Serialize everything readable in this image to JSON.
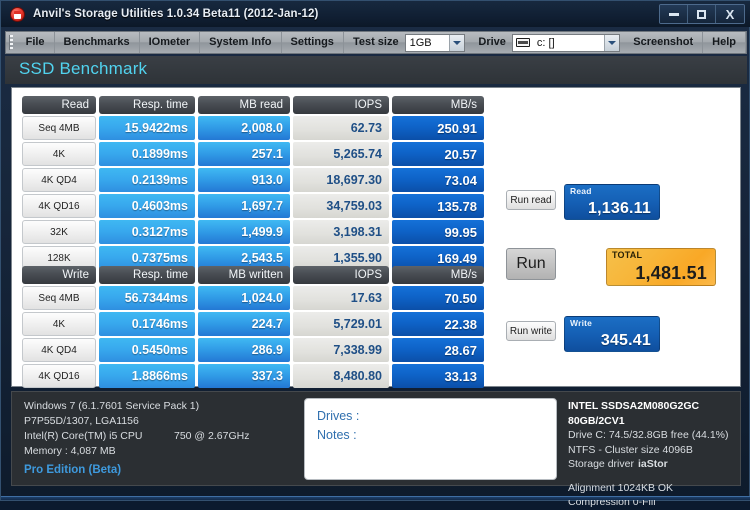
{
  "window": {
    "title": "Anvil's Storage Utilities 1.0.34 Beta11 (2012-Jan-12)",
    "app_icon": "anvil-icon",
    "minimize_label": "",
    "maximize_label": "",
    "close_label": "X"
  },
  "menu": {
    "items": [
      "File",
      "Benchmarks",
      "IOmeter",
      "System Info",
      "Settings"
    ],
    "test_size_label": "Test size",
    "test_size_value": "1GB",
    "drive_label": "Drive",
    "drive_value": "c: []",
    "screenshot_label": "Screenshot",
    "help_label": "Help"
  },
  "header": {
    "title": "SSD Benchmark",
    "accent_color": "#51d3ef"
  },
  "chart_data": {
    "type": "table",
    "title": "SSD Benchmark",
    "tables": [
      {
        "name": "Read",
        "columns": [
          "Read",
          "Resp. time",
          "MB read",
          "IOPS",
          "MB/s"
        ],
        "rows": [
          [
            "Seq 4MB",
            "15.9422ms",
            "2,008.0",
            "62.73",
            "250.91"
          ],
          [
            "4K",
            "0.1899ms",
            "257.1",
            "5,265.74",
            "20.57"
          ],
          [
            "4K QD4",
            "0.2139ms",
            "913.0",
            "18,697.30",
            "73.04"
          ],
          [
            "4K QD16",
            "0.4603ms",
            "1,697.7",
            "34,759.03",
            "135.78"
          ],
          [
            "32K",
            "0.3127ms",
            "1,499.9",
            "3,198.31",
            "99.95"
          ],
          [
            "128K",
            "0.7375ms",
            "2,543.5",
            "1,355.90",
            "169.49"
          ]
        ]
      },
      {
        "name": "Write",
        "columns": [
          "Write",
          "Resp. time",
          "MB written",
          "IOPS",
          "MB/s"
        ],
        "rows": [
          [
            "Seq 4MB",
            "56.7344ms",
            "1,024.0",
            "17.63",
            "70.50"
          ],
          [
            "4K",
            "0.1746ms",
            "224.7",
            "5,729.01",
            "22.38"
          ],
          [
            "4K QD4",
            "0.5450ms",
            "286.9",
            "7,338.99",
            "28.67"
          ],
          [
            "4K QD16",
            "1.8866ms",
            "337.3",
            "8,480.80",
            "33.13"
          ]
        ]
      }
    ],
    "scores": {
      "read": 1136.11,
      "write": 345.41,
      "total": 1481.51
    }
  },
  "read_table": {
    "headers": {
      "label": "Read",
      "resp": "Resp. time",
      "mb": "MB read",
      "iops": "IOPS",
      "mbs": "MB/s"
    },
    "rows": [
      {
        "label": "Seq 4MB",
        "resp": "15.9422ms",
        "mb": "2,008.0",
        "iops": "62.73",
        "mbs": "250.91"
      },
      {
        "label": "4K",
        "resp": "0.1899ms",
        "mb": "257.1",
        "iops": "5,265.74",
        "mbs": "20.57"
      },
      {
        "label": "4K QD4",
        "resp": "0.2139ms",
        "mb": "913.0",
        "iops": "18,697.30",
        "mbs": "73.04"
      },
      {
        "label": "4K QD16",
        "resp": "0.4603ms",
        "mb": "1,697.7",
        "iops": "34,759.03",
        "mbs": "135.78"
      },
      {
        "label": "32K",
        "resp": "0.3127ms",
        "mb": "1,499.9",
        "iops": "3,198.31",
        "mbs": "99.95"
      },
      {
        "label": "128K",
        "resp": "0.7375ms",
        "mb": "2,543.5",
        "iops": "1,355.90",
        "mbs": "169.49"
      }
    ]
  },
  "write_table": {
    "headers": {
      "label": "Write",
      "resp": "Resp. time",
      "mb": "MB written",
      "iops": "IOPS",
      "mbs": "MB/s"
    },
    "rows": [
      {
        "label": "Seq 4MB",
        "resp": "56.7344ms",
        "mb": "1,024.0",
        "iops": "17.63",
        "mbs": "70.50"
      },
      {
        "label": "4K",
        "resp": "0.1746ms",
        "mb": "224.7",
        "iops": "5,729.01",
        "mbs": "22.38"
      },
      {
        "label": "4K QD4",
        "resp": "0.5450ms",
        "mb": "286.9",
        "iops": "7,338.99",
        "mbs": "28.67"
      },
      {
        "label": "4K QD16",
        "resp": "1.8866ms",
        "mb": "337.3",
        "iops": "8,480.80",
        "mbs": "33.13"
      }
    ]
  },
  "scores": {
    "run_read_label": "Run read",
    "run_label": "Run",
    "run_write_label": "Run write",
    "read_caption": "Read",
    "read_value": "1,136.11",
    "total_caption": "TOTAL",
    "total_value": "1,481.51",
    "write_caption": "Write",
    "write_value": "345.41",
    "read_color": "#1560b5",
    "total_color": "#f9a826"
  },
  "sysinfo": {
    "os": "Windows 7 (6.1.7601 Service Pack 1)",
    "board": "P7P55D/1307, LGA1156",
    "cpu_name": "Intel(R) Core(TM) i5 CPU",
    "cpu_model": "750  @ 2.67GHz",
    "memory": "Memory : 4,087 MB",
    "edition": "Pro Edition (Beta)"
  },
  "notes": {
    "drives_label": "Drives :",
    "notes_label": "Notes :"
  },
  "driveinfo": {
    "model": "INTEL SSDSA2M080G2GC 80GB/2CV1",
    "capacity": "Drive C: 74.5/32.8GB free (44.1%)",
    "filesystem": "NTFS - Cluster size 4096B",
    "driver_label": "Storage driver",
    "driver_value": "iaStor",
    "alignment": "Alignment  1024KB OK",
    "compression": "Compression 0-Fill"
  }
}
